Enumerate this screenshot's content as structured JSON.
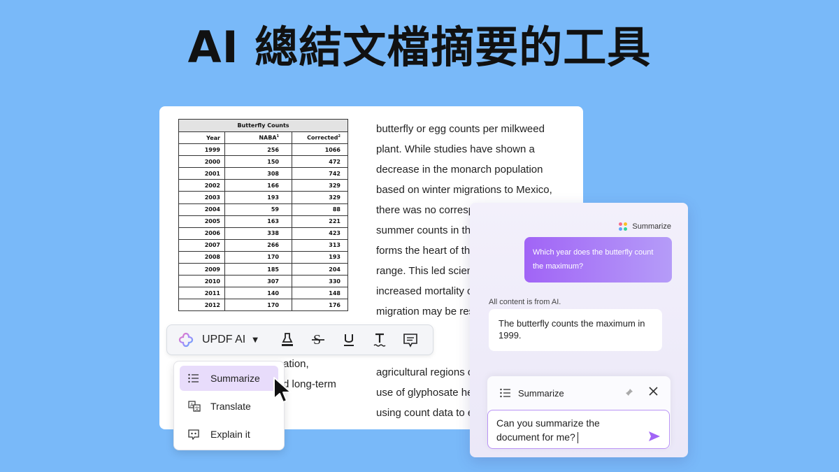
{
  "headline": "AI 總結文檔摘要的工具",
  "document": {
    "table": {
      "caption": "Butterfly Counts",
      "headers": [
        "Year",
        "NABA",
        "Corrected"
      ],
      "header_superscripts": [
        "",
        "1",
        "2"
      ],
      "rows": [
        [
          "1999",
          "256",
          "1066"
        ],
        [
          "2000",
          "150",
          "472"
        ],
        [
          "2001",
          "308",
          "742"
        ],
        [
          "2002",
          "166",
          "329"
        ],
        [
          "2003",
          "193",
          "329"
        ],
        [
          "2004",
          "59",
          "88"
        ],
        [
          "2005",
          "163",
          "221"
        ],
        [
          "2006",
          "338",
          "423"
        ],
        [
          "2007",
          "266",
          "313"
        ],
        [
          "2008",
          "170",
          "193"
        ],
        [
          "2009",
          "185",
          "204"
        ],
        [
          "2010",
          "307",
          "330"
        ],
        [
          "2011",
          "140",
          "148"
        ],
        [
          "2012",
          "170",
          "176"
        ]
      ]
    },
    "paragraph_lines": [
      "butterfly or egg counts per milkweed",
      "plant. While studies have shown a",
      "decrease in the monarch population",
      "based on winter migrations to Mexico,",
      "there was no correspondi",
      "summer counts in th",
      "forms the heart of th",
      "range. This led scien",
      "increased mortality o",
      "migration may be res",
      "",
      "",
      "agricultural regions o",
      "use of glyphosate he",
      "using count data to e"
    ],
    "partial_left_lines": [
      "ation,",
      "d long-term"
    ]
  },
  "toolbar": {
    "updf_label": "UPDF AI",
    "caret": "▼",
    "tools": [
      "highlight-icon",
      "strikethrough-icon",
      "underline-icon",
      "squiggly-text-icon",
      "comment-icon"
    ]
  },
  "menu": {
    "items": [
      {
        "label": "Summarize",
        "icon": "list-icon",
        "active": true
      },
      {
        "label": "Translate",
        "icon": "translate-icon",
        "active": false
      },
      {
        "label": "Explain it",
        "icon": "explain-icon",
        "active": false
      }
    ]
  },
  "ai_panel": {
    "tag_label": "Summarize",
    "question": "Which year does the butterfly count the maximum?",
    "note": "All content is from AI.",
    "answer": "The butterfly counts the maximum in 1999.",
    "composer_mode": "Summarize",
    "input_value": "Can you summarize the document for me?",
    "dot_colors": [
      "#f76b8a",
      "#fbbf24",
      "#60a5fa",
      "#34d399"
    ]
  },
  "colors": {
    "background": "#79b9f9",
    "accent": "#a164f6",
    "menu_active": "#e8dcfb"
  }
}
